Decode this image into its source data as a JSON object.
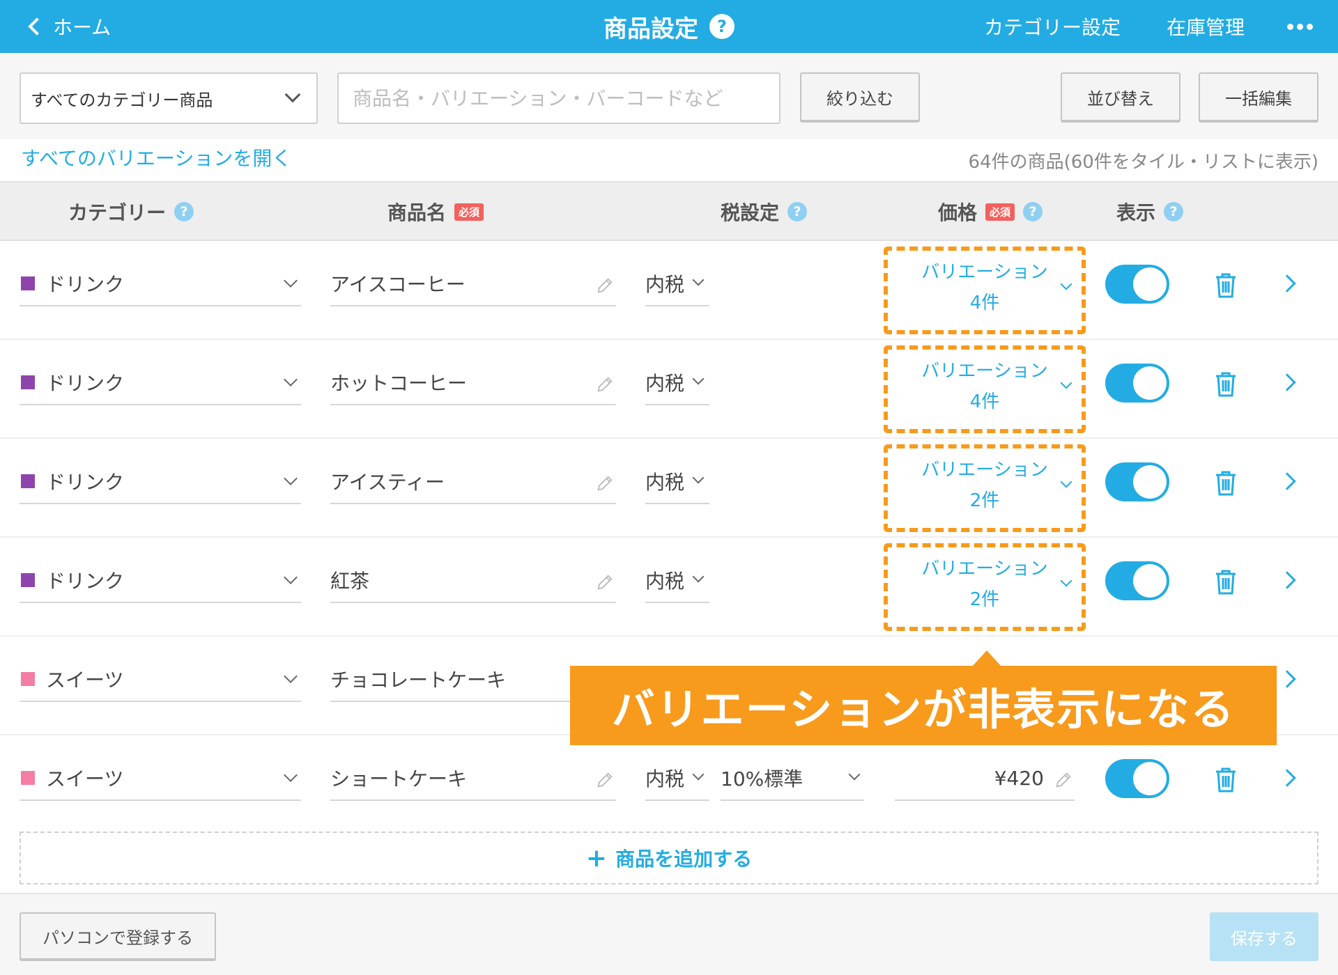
{
  "header": {
    "back_label": "ホーム",
    "title": "商品設定",
    "help_glyph": "?",
    "category_settings": "カテゴリー設定",
    "inventory": "在庫管理"
  },
  "filter": {
    "category_select": "すべてのカテゴリー商品",
    "search_placeholder": "商品名・バリエーション・バーコードなど",
    "filter_button": "絞り込む",
    "sort_button": "並び替え",
    "bulk_edit_button": "一括編集"
  },
  "expand_variations_link": "すべてのバリエーションを開く",
  "product_count_text": "64件の商品(60件をタイル・リストに表示)",
  "table_header": {
    "category": "カテゴリー",
    "product_name": "商品名",
    "tax": "税設定",
    "price": "価格",
    "display": "表示",
    "required_badge": "必須",
    "help_glyph": "?"
  },
  "rows": [
    {
      "category": "ドリンク",
      "category_color": "#8e44ad",
      "name": "アイスコーヒー",
      "tax": "内税",
      "variation_label": "バリエーション",
      "variation_count": "4件",
      "visible": true
    },
    {
      "category": "ドリンク",
      "category_color": "#8e44ad",
      "name": "ホットコーヒー",
      "tax": "内税",
      "variation_label": "バリエーション",
      "variation_count": "4件",
      "visible": true
    },
    {
      "category": "ドリンク",
      "category_color": "#8e44ad",
      "name": "アイスティー",
      "tax": "内税",
      "variation_label": "バリエーション",
      "variation_count": "2件",
      "visible": true
    },
    {
      "category": "ドリンク",
      "category_color": "#8e44ad",
      "name": "紅茶",
      "tax": "内税",
      "variation_label": "バリエーション",
      "variation_count": "2件",
      "visible": true
    },
    {
      "category": "スイーツ",
      "category_color": "#f47ca5",
      "name": "チョコレートケーキ"
    },
    {
      "category": "スイーツ",
      "category_color": "#f47ca5",
      "name": "ショートケーキ",
      "tax": "内税",
      "tax_rate": "10%標準",
      "price": "¥420",
      "visible": true
    }
  ],
  "callout": "バリエーションが非表示になる",
  "add_product": {
    "plus": "+",
    "label": "商品を追加する"
  },
  "footer": {
    "pc_register": "パソコンで登録する",
    "save": "保存する"
  },
  "colors": {
    "accent": "#23ace3",
    "highlight": "#f89a1c",
    "drink": "#8e44ad",
    "sweets": "#f47ca5"
  }
}
